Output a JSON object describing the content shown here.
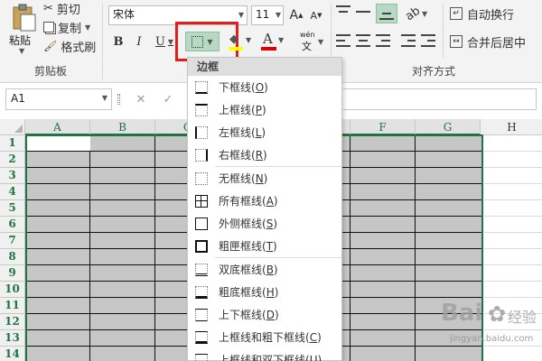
{
  "clipboard": {
    "paste_label": "粘贴",
    "cut_label": "剪切",
    "copy_label": "复制",
    "format_painter_label": "格式刷",
    "group_label": "剪贴板"
  },
  "font": {
    "font_name": "宋体",
    "font_size": "11",
    "grow_label": "A",
    "shrink_label": "A",
    "bold_label": "B",
    "italic_label": "I",
    "underline_label": "U",
    "font_color_label": "A",
    "phonetic_label": "wén",
    "phonetic_sub": "文",
    "font_color_hex": "#e00000",
    "fill_color_hex": "#ffff00"
  },
  "alignment": {
    "wrap_text_label": "自动换行",
    "merge_center_label": "合并后居中",
    "group_label": "对齐方式"
  },
  "formula_bar": {
    "name_box_value": "A1",
    "cancel_label": "✕",
    "enter_label": "✓"
  },
  "grid": {
    "columns": [
      "A",
      "B",
      "C",
      "D",
      "E",
      "F",
      "G",
      "H"
    ],
    "rows": [
      "1",
      "2",
      "3",
      "4",
      "5",
      "6",
      "7",
      "8",
      "9",
      "10",
      "11",
      "12",
      "13",
      "14"
    ],
    "selection_color_hex": "#217346",
    "selected_fill_hex": "#c6c6c6"
  },
  "border_menu": {
    "title": "边框",
    "items": [
      {
        "label": "下框线(",
        "key": "O",
        "icon": "bottom-border-icon"
      },
      {
        "label": "上框线(",
        "key": "P",
        "icon": "top-border-icon"
      },
      {
        "label": "左框线(",
        "key": "L",
        "icon": "left-border-icon"
      },
      {
        "label": "右框线(",
        "key": "R",
        "icon": "right-border-icon"
      },
      {
        "label": "无框线(",
        "key": "N",
        "icon": "no-border-icon"
      },
      {
        "label": "所有框线(",
        "key": "A",
        "icon": "all-borders-icon"
      },
      {
        "label": "外侧框线(",
        "key": "S",
        "icon": "outside-borders-icon"
      },
      {
        "label": "粗匣框线(",
        "key": "T",
        "icon": "thick-box-border-icon"
      },
      {
        "label": "双底框线(",
        "key": "B",
        "icon": "double-bottom-border-icon"
      },
      {
        "label": "粗底框线(",
        "key": "H",
        "icon": "thick-bottom-border-icon"
      },
      {
        "label": "上下框线(",
        "key": "D",
        "icon": "top-bottom-border-icon"
      },
      {
        "label": "上框线和粗下框线(",
        "key": "C",
        "icon": "top-thick-bottom-border-icon"
      },
      {
        "label": "上框线和双下框线(",
        "key": "U",
        "icon": "top-double-bottom-border-icon"
      }
    ]
  },
  "watermark": {
    "text": "Bai",
    "text2": "经验",
    "url": "jingyan.baidu.com"
  }
}
